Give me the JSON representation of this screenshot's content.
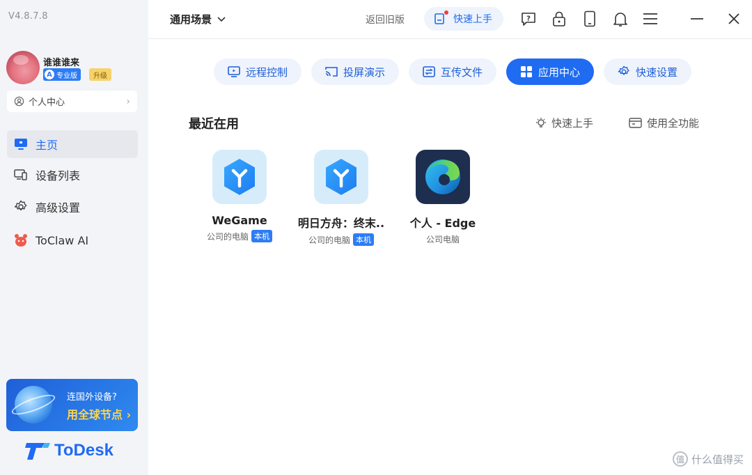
{
  "app": {
    "version": "V4.8.7.8",
    "brand_name": "ToDesk"
  },
  "user": {
    "name": "谁谁谁来",
    "plan_badge": "专业版",
    "upgrade_label": "升级"
  },
  "sidebar": {
    "personal_center": "个人中心",
    "items": [
      {
        "label": "主页",
        "icon": "monitor-icon",
        "active": true
      },
      {
        "label": "设备列表",
        "icon": "devices-icon",
        "active": false
      },
      {
        "label": "高级设置",
        "icon": "gear-icon",
        "active": false
      },
      {
        "label": "ToClaw AI",
        "icon": "claw-ai-icon",
        "active": false
      }
    ],
    "promo": {
      "line1": "连国外设备?",
      "line2": "用全球节点 ›"
    }
  },
  "topbar": {
    "scene_label": "通用场景",
    "old_version_label": "返回旧版",
    "quick_start_label": "快速上手"
  },
  "tabs": [
    {
      "label": "远程控制",
      "icon": "remote-control-icon",
      "active": false
    },
    {
      "label": "投屏演示",
      "icon": "cast-icon",
      "active": false
    },
    {
      "label": "互传文件",
      "icon": "file-transfer-icon",
      "active": false
    },
    {
      "label": "应用中心",
      "icon": "app-grid-icon",
      "active": true
    },
    {
      "label": "快速设置",
      "icon": "gear-icon",
      "active": false
    }
  ],
  "recent": {
    "title": "最近在用",
    "quick_start_link": "快速上手",
    "full_features_link": "使用全功能",
    "apps": [
      {
        "name": "WeGame",
        "device": "公司的电脑",
        "tag": "本机",
        "icon": "todesk-app-icon"
      },
      {
        "name": "明日方舟：终末..",
        "device": "公司的电脑",
        "tag": "本机",
        "icon": "todesk-app-icon"
      },
      {
        "name": "个人 - Edge",
        "device": "公司电脑",
        "tag": "",
        "icon": "edge-icon"
      }
    ]
  },
  "watermark": {
    "text": "什么值得买",
    "icon_text": "值"
  },
  "colors": {
    "accent": "#1f6bf2",
    "tab_bg": "#eef3fc",
    "sidebar_bg": "#f3f4f7",
    "promo_highlight": "#ffd44d"
  }
}
